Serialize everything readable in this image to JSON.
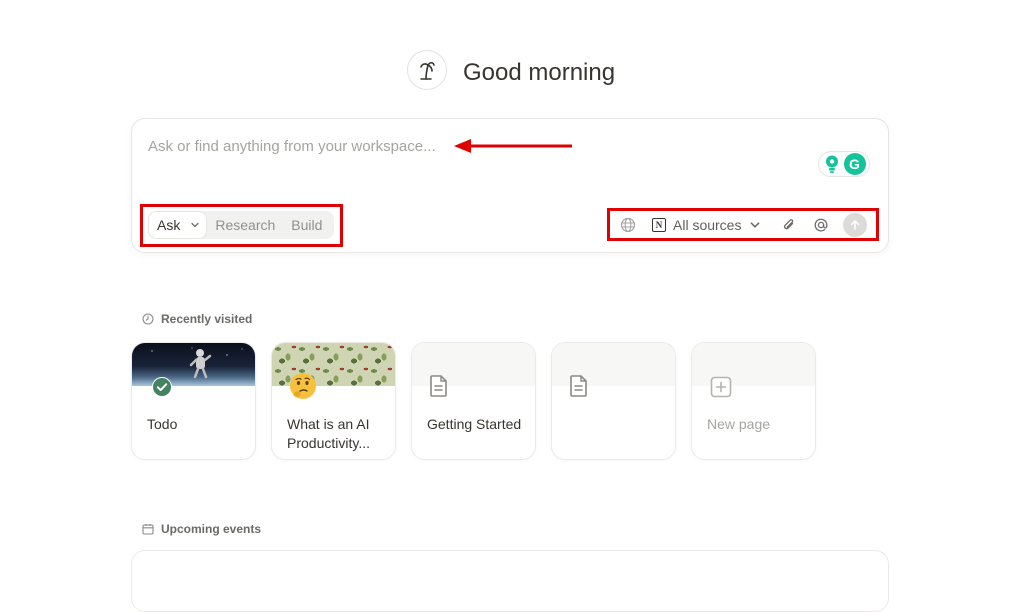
{
  "greeting": {
    "text": "Good morning",
    "avatar_icon": "palm-tree-icon"
  },
  "ask_box": {
    "placeholder": "Ask or find anything from your workspace...",
    "value": "",
    "modes": {
      "active": "Ask",
      "others": [
        "Research",
        "Build"
      ]
    },
    "toolbar": {
      "web_icon": "globe-icon",
      "sources_label": "All sources",
      "attach_icon": "paperclip-icon",
      "mention_icon": "at-icon",
      "send_icon": "arrow-up-icon"
    },
    "extensions": {
      "grammarly_letter": "G"
    }
  },
  "recently_visited": {
    "heading": "Recently visited",
    "items": [
      {
        "title": "Todo",
        "cover": "space-photo",
        "icon": "check-circle-icon"
      },
      {
        "title": "What is an AI Productivity...",
        "cover": "leaf-pattern",
        "icon": "thinking-face-emoji"
      },
      {
        "title": "Getting Started",
        "cover": "plain",
        "icon": "page-icon"
      },
      {
        "title": "",
        "cover": "plain",
        "icon": "page-icon"
      },
      {
        "title": "New page",
        "cover": "plain",
        "icon": "plus-square-icon"
      }
    ]
  },
  "upcoming_events": {
    "heading": "Upcoming events"
  },
  "colors": {
    "annotation_red": "#e00000",
    "text": "#37352f",
    "muted": "#a5a4a0",
    "check_green": "#448361",
    "grammarly_green": "#15c39a"
  }
}
